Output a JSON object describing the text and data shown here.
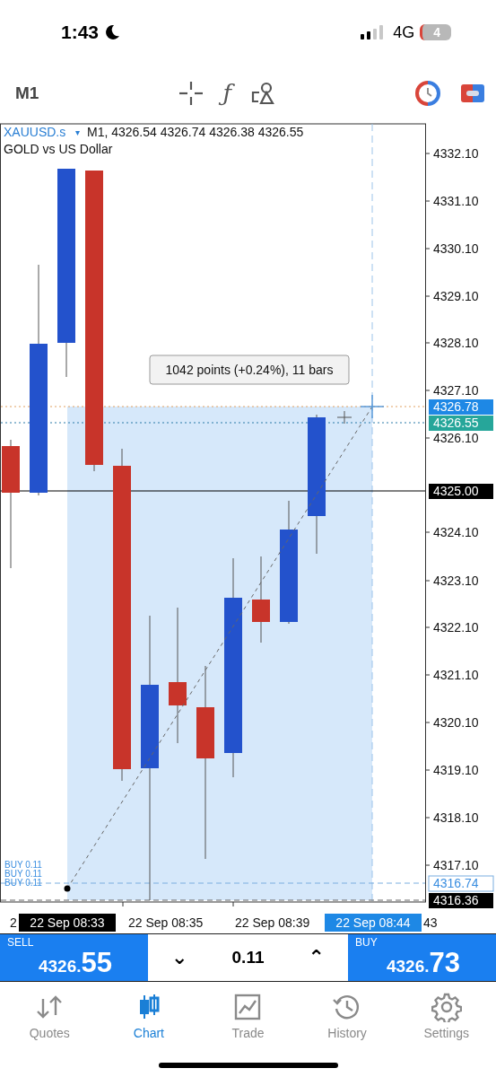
{
  "status_bar": {
    "time": "1:43",
    "network": "4G",
    "battery": "4"
  },
  "toolbar": {
    "timeframe": "M1",
    "indicators_glyph": "ƒ"
  },
  "chart": {
    "symbol": "XAUUSD.s",
    "symbol_caret": "▾",
    "ohlc": "M1, 4326.54 4326.74 4326.38 4326.55",
    "description": "GOLD vs US Dollar",
    "measure_label": "1042 points (+0.24%), 11 bars",
    "price_labels": [
      "4332.10",
      "4331.10",
      "4330.10",
      "4329.10",
      "4328.10",
      "4327.10",
      "4326.10",
      "4324.10",
      "4323.10",
      "4322.10",
      "4321.10",
      "4320.10",
      "4319.10",
      "4318.10",
      "4317.10"
    ],
    "price_markers": [
      "4326.78",
      "4326.55",
      "4325.00",
      "4316.74",
      "4316.36"
    ],
    "order_labels": [
      "BUY 0.11",
      "BUY 0.11",
      "BUY 0.11"
    ],
    "time_labels": [
      "2",
      "22 Sep 08:35",
      "22 Sep 08:39",
      "43"
    ],
    "time_markers": [
      "22 Sep 08:33",
      "22 Sep 08:44"
    ]
  },
  "trade_panel": {
    "sell": {
      "label": "SELL",
      "price_main": "4326.",
      "price_big": "55"
    },
    "volume_down": "⌄",
    "volume": "0.11",
    "volume_up": "⌃",
    "buy": {
      "label": "BUY",
      "price_main": "4326.",
      "price_big": "73"
    }
  },
  "tabs": [
    {
      "label": "Quotes",
      "selected": false
    },
    {
      "label": "Chart",
      "selected": true
    },
    {
      "label": "Trade",
      "selected": false
    },
    {
      "label": "History",
      "selected": false
    },
    {
      "label": "Settings",
      "selected": false
    }
  ]
}
